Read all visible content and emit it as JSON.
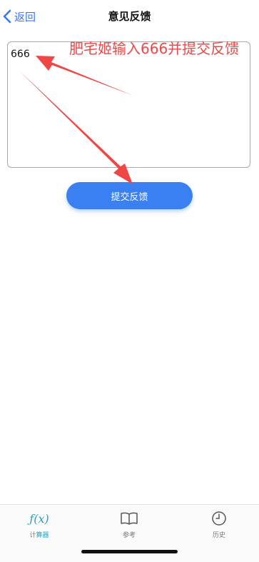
{
  "nav": {
    "back_label": "返回",
    "title": "意见反馈"
  },
  "feedback": {
    "value": "666"
  },
  "submit": {
    "label": "提交反馈"
  },
  "annotation": {
    "text": "肥宅姬输入666并提交反馈",
    "color": "#f04646"
  },
  "tabs": [
    {
      "label": "计算器",
      "icon": "function-fx-icon",
      "glyph": "ƒ(x)",
      "active": true
    },
    {
      "label": "参考",
      "icon": "open-book-icon",
      "active": false
    },
    {
      "label": "历史",
      "icon": "clock-icon",
      "active": false
    }
  ],
  "colors": {
    "accent": "#3a80f3",
    "tab_active": "#2f9fbf",
    "tab_inactive": "#777777"
  }
}
